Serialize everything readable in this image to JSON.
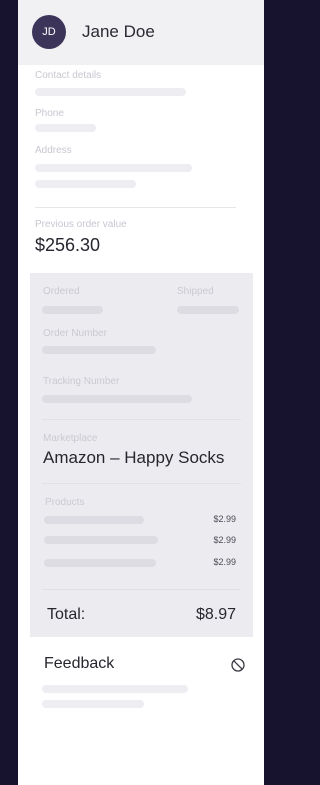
{
  "customer": {
    "initials": "JD",
    "name": "Jane Doe"
  },
  "contact": {
    "label": "Contact details",
    "phone_label": "Phone",
    "address_label": "Address"
  },
  "previous_order": {
    "label": "Previous order value",
    "value": "$256.30"
  },
  "order": {
    "ordered_label": "Ordered",
    "shipped_label": "Shipped",
    "order_number_label": "Order Number",
    "tracking_number_label": "Tracking Number",
    "marketplace_label": "Marketplace",
    "marketplace_value": "Amazon – Happy Socks",
    "products_label": "Products",
    "products": [
      {
        "price": "$2.99"
      },
      {
        "price": "$2.99"
      },
      {
        "price": "$2.99"
      }
    ],
    "total_label": "Total:",
    "total_value": "$8.97"
  },
  "feedback": {
    "title": "Feedback",
    "icon": "block-icon"
  },
  "colors": {
    "background": "#17122e",
    "avatar": "#3d3459",
    "card": "#ececf0"
  }
}
